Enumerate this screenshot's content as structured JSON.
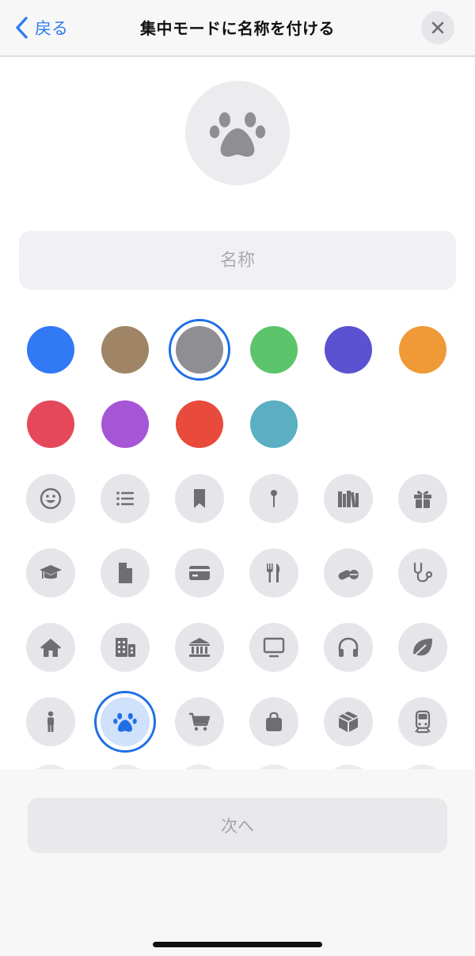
{
  "header": {
    "back_label": "戻る",
    "title": "集中モードに名称を付ける"
  },
  "preview": {
    "icon": "paw-icon"
  },
  "name_field": {
    "placeholder": "名称",
    "value": ""
  },
  "colors": [
    {
      "name": "blue",
      "hex": "#3179f5"
    },
    {
      "name": "brown",
      "hex": "#9f8565"
    },
    {
      "name": "gray",
      "hex": "#8e8e93",
      "selected": true
    },
    {
      "name": "green",
      "hex": "#5cc46a"
    },
    {
      "name": "indigo",
      "hex": "#5a52d0"
    },
    {
      "name": "orange",
      "hex": "#f09a37"
    },
    {
      "name": "red",
      "hex": "#e5485b"
    },
    {
      "name": "purple",
      "hex": "#a555d6"
    },
    {
      "name": "vermilion",
      "hex": "#e84a3c"
    },
    {
      "name": "teal",
      "hex": "#5aafc2"
    }
  ],
  "icons": [
    "smiley-icon",
    "list-icon",
    "bookmark-icon",
    "pin-icon",
    "books-icon",
    "gift-icon",
    "graduation-cap-icon",
    "document-icon",
    "credit-card-icon",
    "fork-knife-icon",
    "pills-icon",
    "stethoscope-icon",
    "house-icon",
    "building-icon",
    "bank-icon",
    "monitor-icon",
    "headphones-icon",
    "leaf-icon",
    "person-icon",
    "paw-icon",
    "cart-icon",
    "bag-icon",
    "box-icon",
    "train-icon"
  ],
  "selected_icon": "paw-icon",
  "accent_color": "#1f6fe5",
  "icon_color": "#6d6d72",
  "next_button": {
    "label": "次へ"
  }
}
